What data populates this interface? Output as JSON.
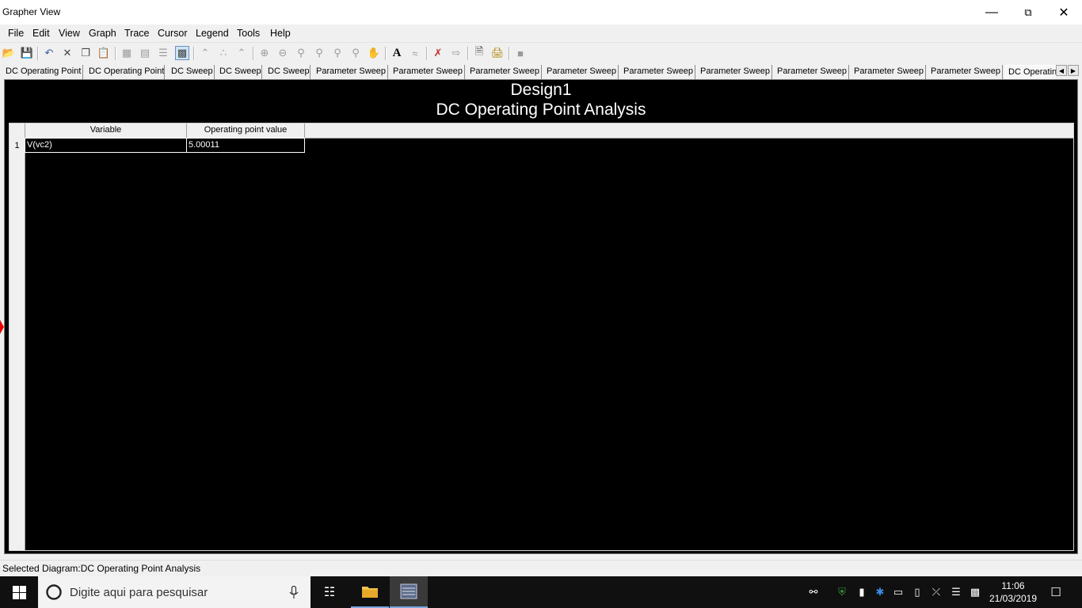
{
  "window": {
    "title": "Grapher View"
  },
  "menu": [
    "File",
    "Edit",
    "View",
    "Graph",
    "Trace",
    "Cursor",
    "Legend",
    "Tools",
    "Help"
  ],
  "tabs": [
    "DC Operating Point",
    "DC Operating Point",
    "DC Sweep",
    "DC Sweep",
    "DC Sweep",
    "Parameter Sweep",
    "Parameter Sweep",
    "Parameter Sweep",
    "Parameter Sweep",
    "Parameter Sweep",
    "Parameter Sweep",
    "Parameter Sweep",
    "Parameter Sweep",
    "Parameter Sweep",
    "DC Operatin"
  ],
  "graph": {
    "title": "Design1",
    "subtitle": "DC Operating Point Analysis",
    "columns": [
      "Variable",
      "Operating point value"
    ],
    "rows": [
      {
        "num": "1",
        "variable": "V(vc2)",
        "value": "5.00011"
      }
    ]
  },
  "status": {
    "text": "Selected Diagram:DC Operating Point Analysis"
  },
  "taskbar": {
    "search_placeholder": "Digite aqui para pesquisar",
    "time": "11:06",
    "date": "21/03/2019"
  }
}
